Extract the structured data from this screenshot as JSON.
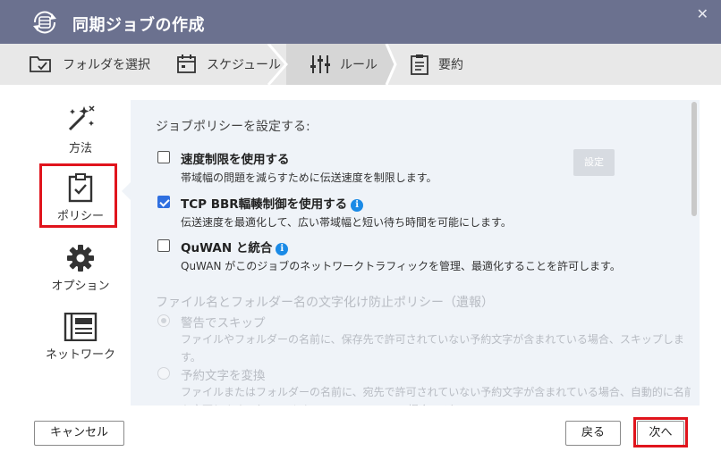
{
  "window": {
    "title": "同期ジョブの作成"
  },
  "steps": [
    {
      "label": "フォルダを選択",
      "icon": "folder-select-icon"
    },
    {
      "label": "スケジュール",
      "icon": "calendar-icon"
    },
    {
      "label": "ルール",
      "icon": "sliders-icon",
      "active": true
    },
    {
      "label": "要約",
      "icon": "summary-clipboard-icon"
    }
  ],
  "leftnav": [
    {
      "label": "方法",
      "icon": "magic-wand-icon"
    },
    {
      "label": "ポリシー",
      "icon": "clipboard-check-icon",
      "selected": true
    },
    {
      "label": "オプション",
      "icon": "gear-icon"
    },
    {
      "label": "ネットワーク",
      "icon": "network-icon"
    }
  ],
  "policy": {
    "heading": "ジョブポリシーを設定する:",
    "options": [
      {
        "label": "速度制限を使用する",
        "desc": "帯域幅の問題を減らすために伝送速度を制限します。",
        "checked": false
      },
      {
        "label": "TCP BBR輻輳制御を使用する",
        "desc": "伝送速度を最適化して、広い帯域幅と短い待ち時間を可能にします。",
        "checked": true
      },
      {
        "label": "QuWAN と統合",
        "desc": "QuWAN がこのジョブのネットワークトラフィックを管理、最適化することを許可します。",
        "checked": false
      }
    ],
    "settings_button": "設定",
    "encoding_heading": "ファイル名とフォルダー名の文字化け防止ポリシー（遺報）",
    "encoding_options": [
      {
        "label": "警告でスキップ",
        "desc": "ファイルやフォルダーの名前に、保存先で許可されていない予約文字が含まれている場合、スキップします。",
        "selected": true
      },
      {
        "label": "予約文字を変換",
        "desc": "ファイルまたはフォルダーの名前に、宛先で許可されていない予約文字が含まれている場合、自動的に名前を変更します。（ソースとしての QNAP NAS の場合のみ）",
        "selected": false
      }
    ]
  },
  "footer": {
    "cancel": "キャンセル",
    "back": "戻る",
    "next": "次へ"
  },
  "colors": {
    "titlebar": "#6b718f",
    "highlight": "#e0141c",
    "checkbox_checked": "#2f6fe0",
    "info": "#1a8ae6",
    "panel": "#eff3f8"
  }
}
